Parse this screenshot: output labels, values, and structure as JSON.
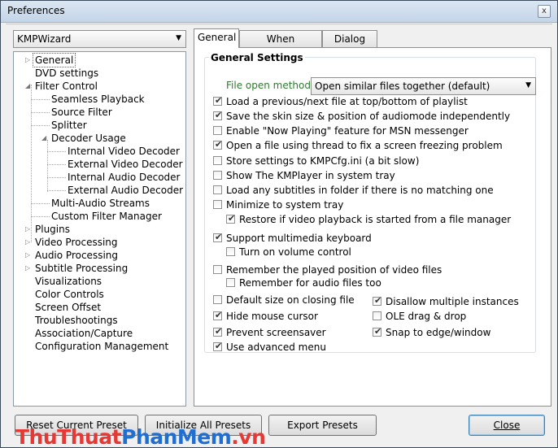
{
  "window": {
    "title": "Preferences",
    "close_glyph": "x"
  },
  "preset_combo": {
    "value": "KMPWizard"
  },
  "tree": {
    "items": [
      {
        "label": "General"
      },
      {
        "label": "DVD settings"
      },
      {
        "label": "Filter Control"
      },
      {
        "label": "Seamless Playback"
      },
      {
        "label": "Source Filter"
      },
      {
        "label": "Splitter"
      },
      {
        "label": "Decoder Usage"
      },
      {
        "label": "Internal Video Decoder"
      },
      {
        "label": "External Video Decoder"
      },
      {
        "label": "Internal Audio Decoder"
      },
      {
        "label": "External Audio Decoder"
      },
      {
        "label": "Multi-Audio Streams"
      },
      {
        "label": "Custom Filter Manager"
      },
      {
        "label": "Plugins"
      },
      {
        "label": "Video Processing"
      },
      {
        "label": "Audio Processing"
      },
      {
        "label": "Subtitle Processing"
      },
      {
        "label": "Visualizations"
      },
      {
        "label": "Color Controls"
      },
      {
        "label": "Screen Offset"
      },
      {
        "label": "Troubleshootings"
      },
      {
        "label": "Association/Capture"
      },
      {
        "label": "Configuration Management"
      }
    ]
  },
  "tabs": [
    {
      "label": "General"
    },
    {
      "label": "When Starting..."
    },
    {
      "label": "Dialog Box"
    }
  ],
  "general": {
    "group_title": "General Settings",
    "file_open_label": "File open method:",
    "file_open_value": "Open similar files together (default)",
    "checkboxes": [
      {
        "label": "Load a previous/next file at top/bottom of playlist",
        "checked": true
      },
      {
        "label": "Save the skin size & position of audiomode independently",
        "checked": true
      },
      {
        "label": "Enable \"Now Playing\" feature for MSN messenger",
        "checked": false
      },
      {
        "label": "Open a file using thread to fix a screen freezing problem",
        "checked": true
      },
      {
        "label": "Store settings to KMPCfg.ini (a bit slow)",
        "checked": false
      },
      {
        "label": "Show The KMPlayer in system tray",
        "checked": false
      },
      {
        "label": "Load any subtitles in folder if there is no matching one",
        "checked": false
      },
      {
        "label": "Minimize to system tray",
        "checked": false
      },
      {
        "label": "Restore if video playback is started from a file manager",
        "checked": true
      },
      {
        "label": "Support multimedia keyboard",
        "checked": true
      },
      {
        "label": "Turn on volume control",
        "checked": false
      },
      {
        "label": "Remember the played position of video files",
        "checked": false
      },
      {
        "label": "Remember for audio files too",
        "checked": false
      },
      {
        "label": "Default size on closing file",
        "checked": false
      },
      {
        "label": "Disallow multiple instances",
        "checked": true
      },
      {
        "label": "Hide mouse cursor",
        "checked": true
      },
      {
        "label": "OLE drag & drop",
        "checked": false
      },
      {
        "label": "Prevent screensaver",
        "checked": true
      },
      {
        "label": "Snap to edge/window",
        "checked": true
      },
      {
        "label": "Use advanced menu",
        "checked": true
      }
    ]
  },
  "buttons": {
    "reset": "Reset Current Preset",
    "initialize": "Initialize All Presets",
    "export": "Export Presets",
    "close": "Close"
  },
  "watermark": {
    "part1": "ThuThuat",
    "part2": "PhanMem",
    "part3": ".vn"
  },
  "colors": {
    "file_open_label": "#2f7a2f",
    "watermark_red": "#e53935",
    "watermark_blue": "#1e6fd1"
  }
}
